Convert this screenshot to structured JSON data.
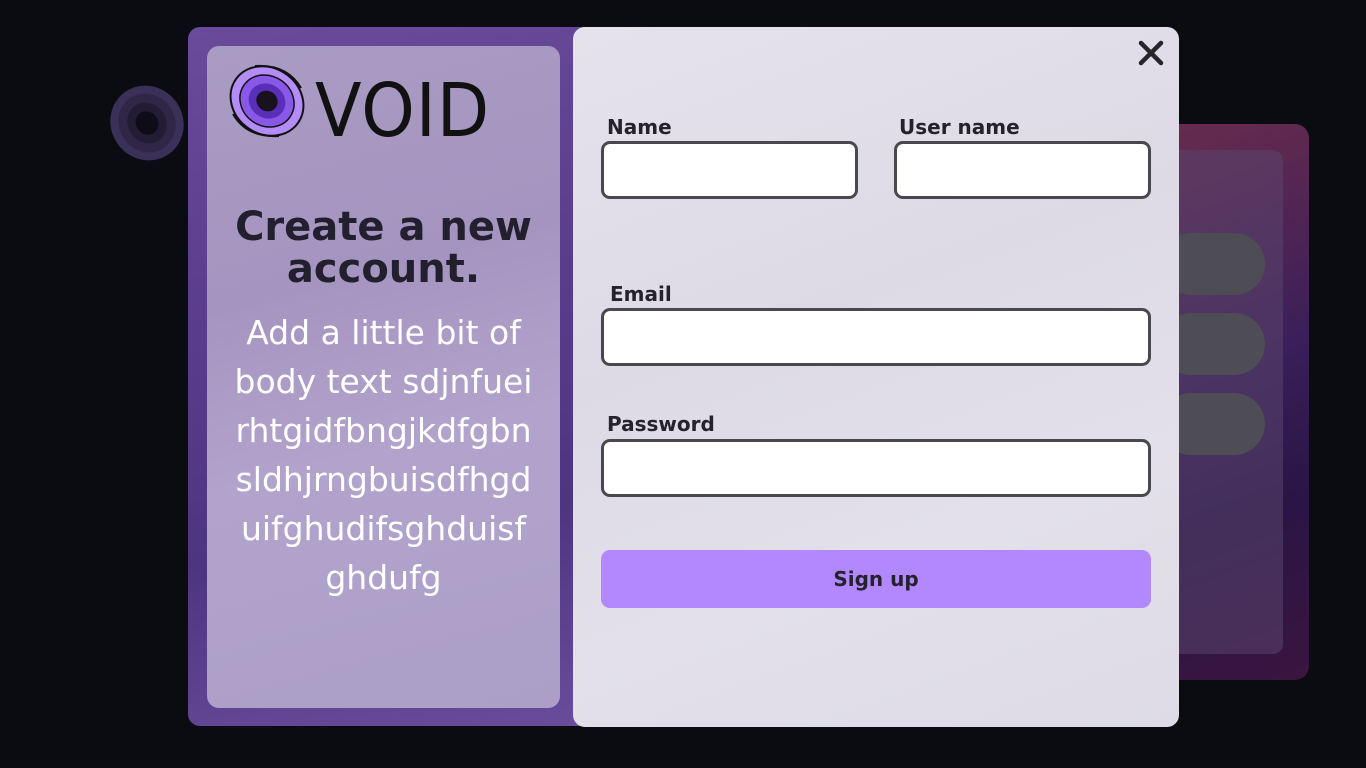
{
  "brand": {
    "name": "VOID",
    "accent_color": "#b388fe"
  },
  "left_panel": {
    "title": "Create a new account.",
    "body": "Add a little bit of body text sdjnfueirhtgidfbngjkdfgbnsldhjrngbuisdfhgduifghudifsghduisfghdufg"
  },
  "form": {
    "name_label": "Name",
    "name_value": "",
    "username_label": "User name",
    "username_value": "",
    "email_label": "Email",
    "email_value": "",
    "password_label": "Password",
    "password_value": "",
    "submit_label": "Sign up"
  },
  "icons": {
    "close": "close-icon",
    "logo": "void-logo-icon"
  }
}
